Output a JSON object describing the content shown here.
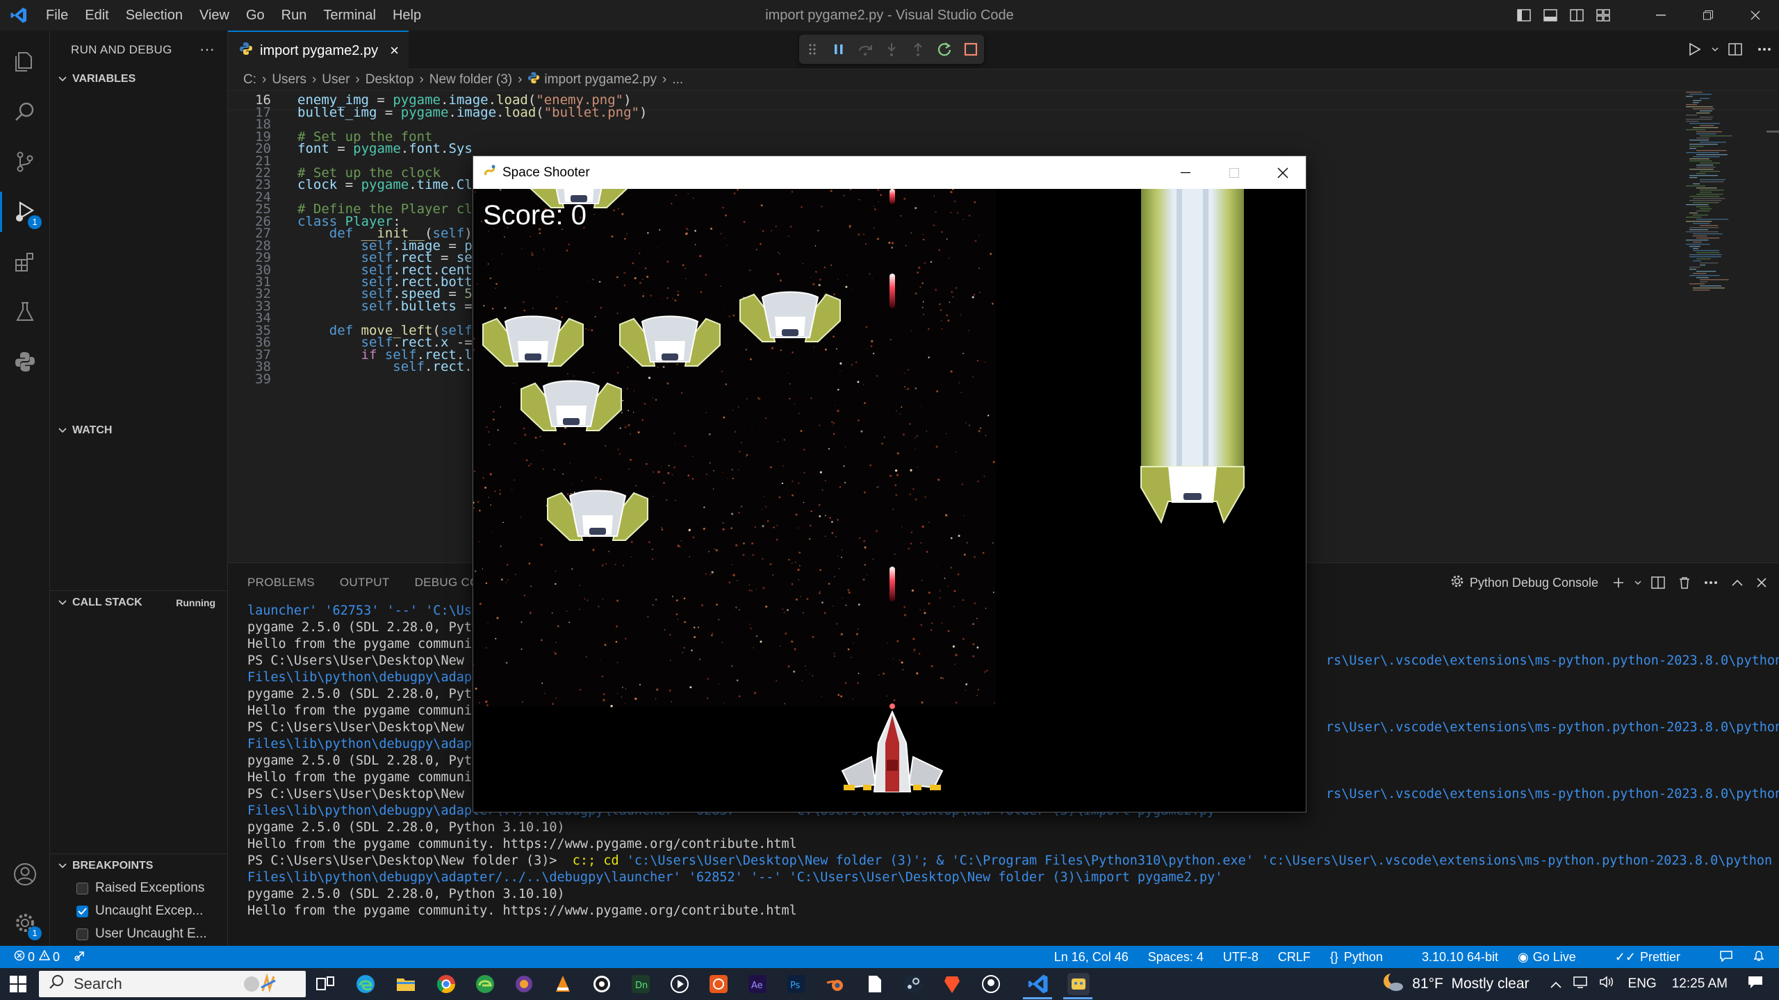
{
  "titlebar": {
    "menu": [
      "File",
      "Edit",
      "Selection",
      "View",
      "Go",
      "Run",
      "Terminal",
      "Help"
    ],
    "window_title": "import pygame2.py - Visual Studio Code"
  },
  "activity": {
    "debug_badge": "1",
    "settings_badge": "1"
  },
  "sidebar": {
    "header": "RUN AND DEBUG",
    "variables": "VARIABLES",
    "watch": "WATCH",
    "call_stack": "CALL STACK",
    "call_stack_status": "Running",
    "breakpoints": "BREAKPOINTS",
    "breakpoint_items": [
      {
        "label": "Raised Exceptions",
        "checked": false
      },
      {
        "label": "Uncaught Excep...",
        "checked": true
      },
      {
        "label": "User Uncaught E...",
        "checked": false
      }
    ]
  },
  "tab": {
    "label": "import pygame2.py",
    "close": "×"
  },
  "breadcrumb": [
    "C:",
    "Users",
    "User",
    "Desktop",
    "New folder (3)",
    "import pygame2.py",
    "..."
  ],
  "editor": {
    "lines": [
      {
        "n": "16",
        "text": "enemy_img = pygame.image.load(\"enemy.png\")"
      },
      {
        "n": "17",
        "text": "bullet_img = pygame.image.load(\"bullet.png\")"
      },
      {
        "n": "18",
        "text": ""
      },
      {
        "n": "19",
        "text": "# Set up the font"
      },
      {
        "n": "20",
        "text": "font = pygame.font.Sys"
      },
      {
        "n": "21",
        "text": ""
      },
      {
        "n": "22",
        "text": "# Set up the clock"
      },
      {
        "n": "23",
        "text": "clock = pygame.time.Cl"
      },
      {
        "n": "24",
        "text": ""
      },
      {
        "n": "25",
        "text": "# Define the Player cl"
      },
      {
        "n": "26",
        "text": "class Player:"
      },
      {
        "n": "27",
        "text": "    def __init__(self)"
      },
      {
        "n": "28",
        "text": "        self.image = p"
      },
      {
        "n": "29",
        "text": "        self.rect = se"
      },
      {
        "n": "30",
        "text": "        self.rect.cent"
      },
      {
        "n": "31",
        "text": "        self.rect.bott"
      },
      {
        "n": "32",
        "text": "        self.speed = 5"
      },
      {
        "n": "33",
        "text": "        self.bullets ="
      },
      {
        "n": "34",
        "text": ""
      },
      {
        "n": "35",
        "text": "    def move_left(self"
      },
      {
        "n": "36",
        "text": "        self.rect.x -="
      },
      {
        "n": "37",
        "text": "        if self.rect.l"
      },
      {
        "n": "38",
        "text": "            self.rect."
      },
      {
        "n": "39",
        "text": ""
      }
    ]
  },
  "panel": {
    "tabs": [
      "PROBLEMS",
      "OUTPUT",
      "DEBUG CONSO"
    ],
    "console_name": "Python Debug Console",
    "terminal": [
      {
        "text": "launcher' '62753' '--' 'C:\\Use",
        "right": ""
      },
      {
        "text": "pygame 2.5.0 (SDL 2.28.0, Pyth",
        "right": ""
      },
      {
        "text": "Hello from the pygame communi",
        "right": ""
      },
      {
        "text": "PS C:\\Users\\User\\Desktop\\New ",
        "right": "rs\\User\\.vscode\\extensions\\ms-python.python-2023.8.0\\python"
      },
      {
        "text": "Files\\lib\\python\\debugpy\\adapt",
        "right": ""
      },
      {
        "text": "pygame 2.5.0 (SDL 2.28.0, Pyth",
        "right": ""
      },
      {
        "text": "Hello from the pygame communi",
        "right": ""
      },
      {
        "text": "PS C:\\Users\\User\\Desktop\\New ",
        "right": "rs\\User\\.vscode\\extensions\\ms-python.python-2023.8.0\\python"
      },
      {
        "text": "Files\\lib\\python\\debugpy\\adapt",
        "right": ""
      },
      {
        "text": "pygame 2.5.0 (SDL 2.28.0, Pyth",
        "right": ""
      },
      {
        "text": "Hello from the pygame communi",
        "right": ""
      },
      {
        "text": "PS C:\\Users\\User\\Desktop\\New ",
        "right": "rs\\User\\.vscode\\extensions\\ms-python.python-2023.8.0\\python"
      },
      {
        "text": "Files\\lib\\python\\debugpy\\adapter\\../..\\debugpy\\launcher' '62837' '--' 'C:\\Users\\User\\Desktop\\New folder (3)\\import pygame2.py'",
        "right": ""
      },
      {
        "text": "pygame 2.5.0 (SDL 2.28.0, Python 3.10.10)",
        "right": ""
      },
      {
        "text": "Hello from the pygame community. https://www.pygame.org/contribute.html",
        "right": ""
      },
      {
        "text": "PS C:\\Users\\User\\Desktop\\New folder (3)>  c:; cd 'c:\\Users\\User\\Desktop\\New folder (3)'; & 'C:\\Program Files\\Python310\\python.exe' 'c:\\Users\\User\\.vscode\\extensions\\ms-python.python-2023.8.0\\python",
        "right": ""
      },
      {
        "text": "Files\\lib\\python\\debugpy\\adapter/../..\\debugpy\\launcher' '62852' '--' 'C:\\Users\\User\\Desktop\\New folder (3)\\import pygame2.py'",
        "right": ""
      },
      {
        "text": "pygame 2.5.0 (SDL 2.28.0, Python 3.10.10)",
        "right": ""
      },
      {
        "text": "Hello from the pygame community. https://www.pygame.org/contribute.html",
        "right": ""
      }
    ]
  },
  "statusbar": {
    "errors": "0",
    "warnings": "0",
    "position": "Ln 16, Col 46",
    "spaces": "Spaces: 4",
    "encoding": "UTF-8",
    "eol": "CRLF",
    "language": "Python",
    "interpreter": "3.10.10 64-bit",
    "golive": "Go Live",
    "prettier": "Prettier"
  },
  "taskbar": {
    "search": "Search",
    "weather": "81°F  Mostly clear",
    "lang": "ENG",
    "time": "12:25 AM"
  },
  "game": {
    "window_title": "Space Shooter",
    "score": "Score: 0"
  },
  "colors": {
    "accent": "#0078d4",
    "editor_bg": "#1f1f1f",
    "sidebar_bg": "#181818"
  }
}
